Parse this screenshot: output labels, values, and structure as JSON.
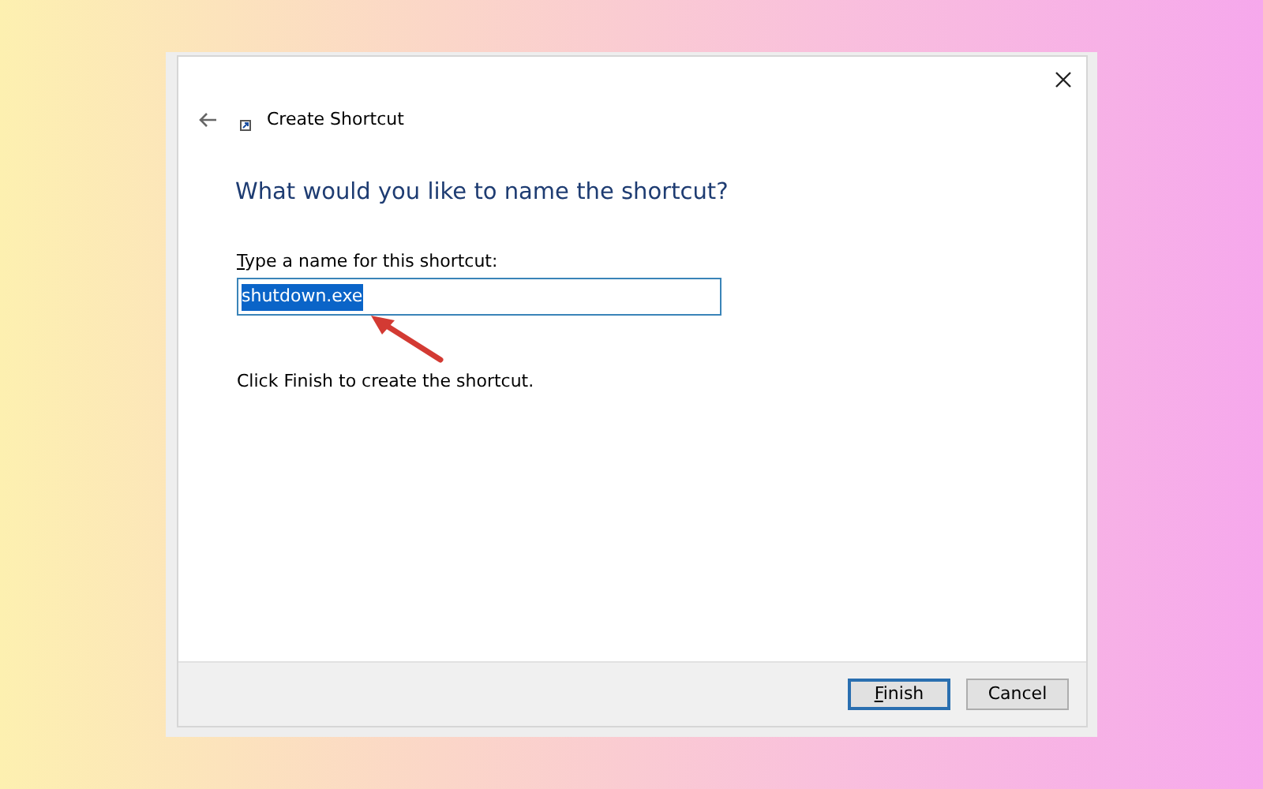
{
  "window": {
    "title": "Create Shortcut"
  },
  "heading": "What would you like to name the shortcut?",
  "name_field": {
    "label": "Type a name for this shortcut:",
    "first_letter_underlined": true,
    "value": "shutdown.exe",
    "selected": true
  },
  "hint": "Click Finish to create the shortcut.",
  "buttons": [
    {
      "label": "Finish",
      "first_letter_underlined": true,
      "default": true
    },
    {
      "label": "Cancel",
      "first_letter_underlined": false,
      "default": false
    }
  ]
}
